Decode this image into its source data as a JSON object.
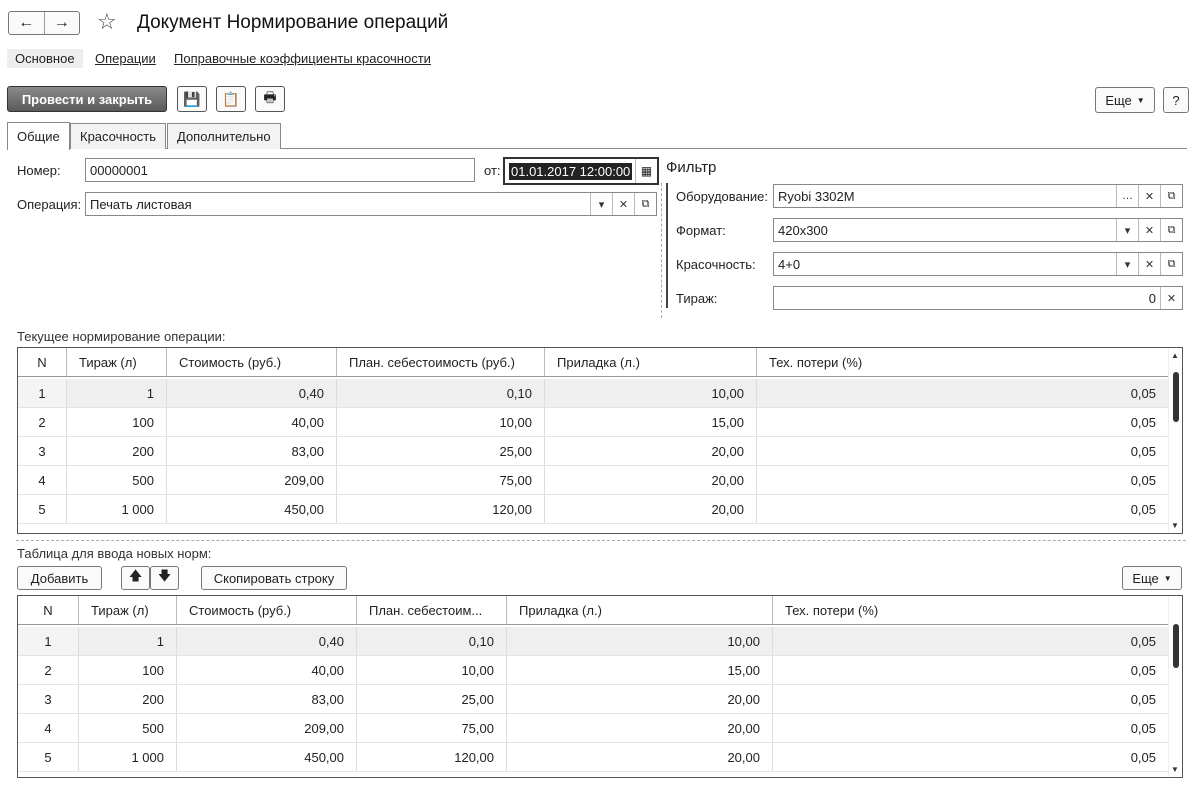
{
  "window": {
    "title": "Документ Нормирование операций"
  },
  "nav": {
    "back": "←",
    "forward": "→",
    "star": "☆"
  },
  "sections": [
    "Основное",
    "Операции",
    "Поправочные коэффициенты красочности"
  ],
  "toolbar": {
    "post_close": "Провести и закрыть",
    "save_icon": "💾",
    "report_icon": "📋",
    "print_icon": "🖶",
    "more": "Еще",
    "help": "?"
  },
  "tabs": [
    "Общие",
    "Красочность",
    "Дополнительно"
  ],
  "form": {
    "number_label": "Номер:",
    "number_value": "00000001",
    "from_label": "от:",
    "date_value": "01.01.2017 12:00:00",
    "operation_label": "Операция:",
    "operation_value": "Печать листовая"
  },
  "filter": {
    "title": "Фильтр",
    "equipment_label": "Оборудование:",
    "equipment_value": "Ryobi 3302M",
    "format_label": "Формат:",
    "format_value": "420x300",
    "colorness_label": "Красочность:",
    "colorness_value": "4+0",
    "run_label": "Тираж:",
    "run_value": "0"
  },
  "current_table": {
    "label": "Текущее нормирование операции:",
    "columns": [
      "N",
      "Тираж (л)",
      "Стоимость (руб.)",
      "План. себестоимость (руб.)",
      "Приладка (л.)",
      "Тех. потери (%)"
    ],
    "rows": [
      [
        "1",
        "1",
        "0,40",
        "0,10",
        "10,00",
        "0,05"
      ],
      [
        "2",
        "100",
        "40,00",
        "10,00",
        "15,00",
        "0,05"
      ],
      [
        "3",
        "200",
        "83,00",
        "25,00",
        "20,00",
        "0,05"
      ],
      [
        "4",
        "500",
        "209,00",
        "75,00",
        "20,00",
        "0,05"
      ],
      [
        "5",
        "1 000",
        "450,00",
        "120,00",
        "20,00",
        "0,05"
      ]
    ]
  },
  "new_table": {
    "label": "Таблица для ввода новых норм:",
    "add": "Добавить",
    "up": "🡅",
    "down": "🡇",
    "copy_row": "Скопировать строку",
    "more": "Еще",
    "columns": [
      "N",
      "Тираж (л)",
      "Стоимость (руб.)",
      "План. себестоим...",
      "Приладка (л.)",
      "Тех. потери (%)"
    ],
    "rows": [
      [
        "1",
        "1",
        "0,40",
        "0,10",
        "10,00",
        "0,05"
      ],
      [
        "2",
        "100",
        "40,00",
        "10,00",
        "15,00",
        "0,05"
      ],
      [
        "3",
        "200",
        "83,00",
        "25,00",
        "20,00",
        "0,05"
      ],
      [
        "4",
        "500",
        "209,00",
        "75,00",
        "20,00",
        "0,05"
      ],
      [
        "5",
        "1 000",
        "450,00",
        "120,00",
        "20,00",
        "0,05"
      ]
    ]
  }
}
